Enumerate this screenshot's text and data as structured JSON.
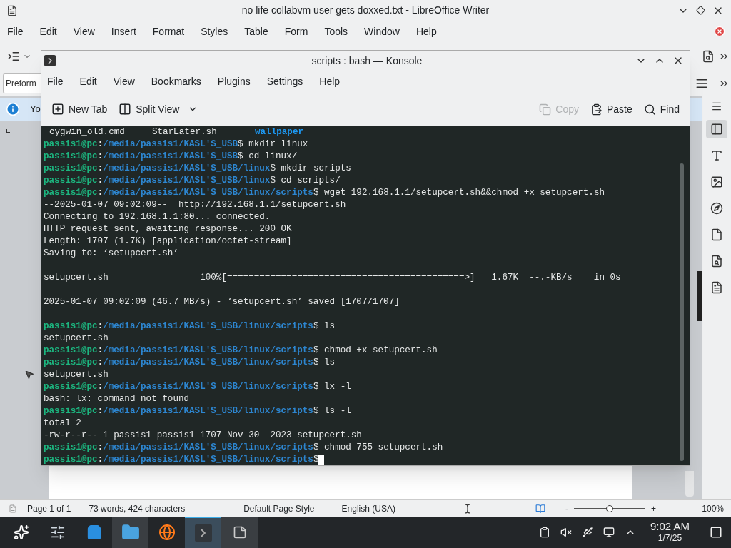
{
  "writer": {
    "title": "no life collabvm user gets doxxed.txt - LibreOffice Writer",
    "menu": [
      "File",
      "Edit",
      "View",
      "Insert",
      "Format",
      "Styles",
      "Table",
      "Form",
      "Tools",
      "Window",
      "Help"
    ],
    "paragraph_style": "Preform",
    "infobar_text": "Yo",
    "sidebar_tabs": [
      {
        "selected": true
      },
      {
        "selected": false
      },
      {
        "selected": false
      },
      {
        "selected": false
      },
      {
        "selected": false
      },
      {
        "selected": false
      },
      {
        "selected": false
      }
    ],
    "status_bar": {
      "page": "Page 1 of 1",
      "words": "73 words, 424 characters",
      "page_style": "Default Page Style",
      "language": "English (USA)",
      "zoom_minus": "-",
      "zoom_plus": "+",
      "zoom": {
        "level": 0.5
      },
      "zoom_text": "100%"
    }
  },
  "konsole": {
    "title": "scripts : bash — Konsole",
    "menu": [
      "File",
      "Edit",
      "View",
      "Bookmarks",
      "Plugins",
      "Settings",
      "Help"
    ],
    "toolbar_left": [
      {
        "label": "New Tab"
      },
      {
        "label": "Split View"
      }
    ],
    "toolbar_right": [
      {
        "label": "Copy",
        "disabled": true
      },
      {
        "label": "Paste",
        "disabled": false
      },
      {
        "label": "Find",
        "disabled": false
      }
    ],
    "lines": [
      {
        "kind": "listing",
        "items": [
          {
            "text": "cygwin_old.cmd",
            "dir": false
          },
          {
            "text": "StarEater.sh",
            "dir": false
          },
          {
            "text": "wallpaper",
            "dir": true
          }
        ]
      },
      {
        "kind": "prompt",
        "user": "passis1@pc",
        "sep": ":",
        "path": "/media/passis1/KASL'S_USB",
        "sigil": "$",
        "command": " mkdir linux",
        "cursor": false
      },
      {
        "kind": "prompt",
        "user": "passis1@pc",
        "sep": ":",
        "path": "/media/passis1/KASL'S_USB",
        "sigil": "$",
        "command": " cd linux/",
        "cursor": false
      },
      {
        "kind": "prompt",
        "user": "passis1@pc",
        "sep": ":",
        "path": "/media/passis1/KASL'S_USB/linux",
        "sigil": "$",
        "command": " mkdir scripts",
        "cursor": false
      },
      {
        "kind": "prompt",
        "user": "passis1@pc",
        "sep": ":",
        "path": "/media/passis1/KASL'S_USB/linux",
        "sigil": "$",
        "command": " cd scripts/",
        "cursor": false
      },
      {
        "kind": "prompt",
        "user": "passis1@pc",
        "sep": ":",
        "path": "/media/passis1/KASL'S_USB/linux/scripts",
        "sigil": "$",
        "command": " wget 192.168.1.1/setupcert.sh&&chmod +x setupcert.sh",
        "cursor": false
      },
      {
        "kind": "output",
        "text": "--2025-01-07 09:02:09--  http://192.168.1.1/setupcert.sh"
      },
      {
        "kind": "output",
        "text": "Connecting to 192.168.1.1:80... connected."
      },
      {
        "kind": "output",
        "text": "HTTP request sent, awaiting response... 200 OK"
      },
      {
        "kind": "output",
        "text": "Length: 1707 (1.7K) [application/octet-stream]"
      },
      {
        "kind": "output",
        "text": "Saving to: ‘setupcert.sh’"
      },
      {
        "kind": "blank"
      },
      {
        "kind": "output",
        "text": "setupcert.sh                 100%[============================================>]   1.67K  --.-KB/s    in 0s"
      },
      {
        "kind": "blank"
      },
      {
        "kind": "output",
        "text": "2025-01-07 09:02:09 (46.7 MB/s) - ‘setupcert.sh’ saved [1707/1707]"
      },
      {
        "kind": "blank"
      },
      {
        "kind": "prompt",
        "user": "passis1@pc",
        "sep": ":",
        "path": "/media/passis1/KASL'S_USB/linux/scripts",
        "sigil": "$",
        "command": " ls",
        "cursor": false
      },
      {
        "kind": "output",
        "text": "setupcert.sh"
      },
      {
        "kind": "prompt",
        "user": "passis1@pc",
        "sep": ":",
        "path": "/media/passis1/KASL'S_USB/linux/scripts",
        "sigil": "$",
        "command": " chmod +x setupcert.sh",
        "cursor": false
      },
      {
        "kind": "prompt",
        "user": "passis1@pc",
        "sep": ":",
        "path": "/media/passis1/KASL'S_USB/linux/scripts",
        "sigil": "$",
        "command": " ls",
        "cursor": false
      },
      {
        "kind": "output",
        "text": "setupcert.sh"
      },
      {
        "kind": "prompt",
        "user": "passis1@pc",
        "sep": ":",
        "path": "/media/passis1/KASL'S_USB/linux/scripts",
        "sigil": "$",
        "command": " lx -l",
        "cursor": false
      },
      {
        "kind": "output",
        "text": "bash: lx: command not found"
      },
      {
        "kind": "prompt",
        "user": "passis1@pc",
        "sep": ":",
        "path": "/media/passis1/KASL'S_USB/linux/scripts",
        "sigil": "$",
        "command": " ls -l",
        "cursor": false
      },
      {
        "kind": "output",
        "text": "total 2"
      },
      {
        "kind": "output",
        "text": "-rw-r--r-- 1 passis1 passis1 1707 Nov 30  2023 setupcert.sh"
      },
      {
        "kind": "prompt",
        "user": "passis1@pc",
        "sep": ":",
        "path": "/media/passis1/KASL'S_USB/linux/scripts",
        "sigil": "$",
        "command": " chmod 755 setupcert.sh",
        "cursor": false
      },
      {
        "kind": "prompt",
        "user": "passis1@pc",
        "sep": ":",
        "path": "/media/passis1/KASL'S_USB/linux/scripts",
        "sigil": "$",
        "cursor": true
      }
    ]
  },
  "taskbar": {
    "tasks": [
      {
        "open": false,
        "selected": false
      },
      {
        "open": false,
        "selected": false
      },
      {
        "open": false,
        "selected": false
      },
      {
        "open": true,
        "selected": false
      },
      {
        "open": false,
        "selected": false
      },
      {
        "open": true,
        "selected": true
      },
      {
        "open": true,
        "selected": false
      }
    ],
    "time": "9:02 AM",
    "date": "1/7/25"
  }
}
